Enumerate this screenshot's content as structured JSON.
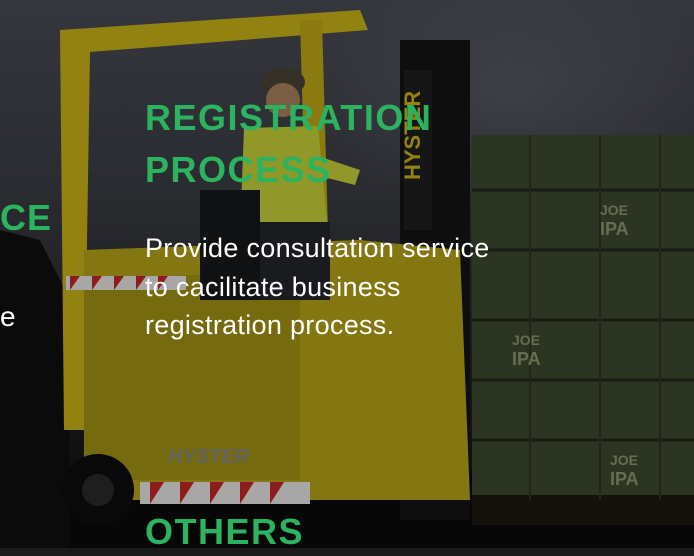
{
  "left_section": {
    "heading_fragment": "CE",
    "body_fragment": "e"
  },
  "service": {
    "heading_line1": "REGISTRATION",
    "heading_line2": "PROCESS",
    "description": "Provide consultation service to cacilitate business registration process."
  },
  "next_section": {
    "heading": "OTHERS"
  },
  "image": {
    "forklift_brand_mast": "HYSTER",
    "forklift_brand_body": "HYSTER",
    "crate_label_line1": "JOE",
    "crate_label_line2": "IPA"
  },
  "colors": {
    "accent_green": "#2bb35f",
    "text_white": "#ffffff",
    "forklift_yellow": "#d9c417"
  }
}
